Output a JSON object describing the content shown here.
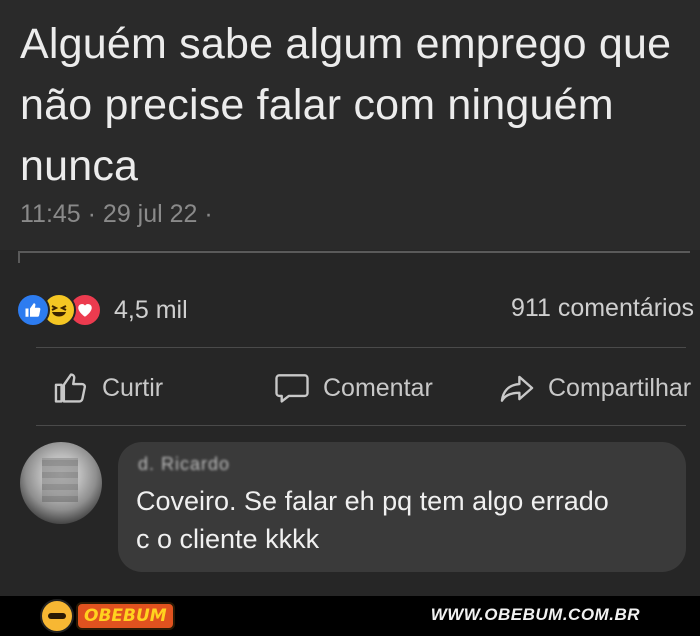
{
  "tweet": {
    "line1": "Alguém sabe algum emprego que",
    "line2": "não precise falar com ninguém",
    "line3": "nunca",
    "meta": "11:45 · 29 jul 22 ·"
  },
  "post_stats": {
    "reaction_icons": [
      "like-icon",
      "haha-icon",
      "love-icon"
    ],
    "reaction_colors": {
      "like": "#2d7cf0",
      "haha": "#f4c623",
      "love": "#ec3b4f"
    },
    "reactions_count": "4,5 mil",
    "comments_count": "911 comentários"
  },
  "actions": {
    "like_label": "Curtir",
    "comment_label": "Comentar",
    "share_label": "Compartilhar"
  },
  "comment": {
    "author_name": "d. Ricardo",
    "text_line1": "Coveiro. Se falar eh pq tem algo errado",
    "text_line2": "c o cliente kkkk"
  },
  "footer": {
    "brand": "OBEBUM",
    "url": "WWW.OBEBUM.COM.BR"
  }
}
